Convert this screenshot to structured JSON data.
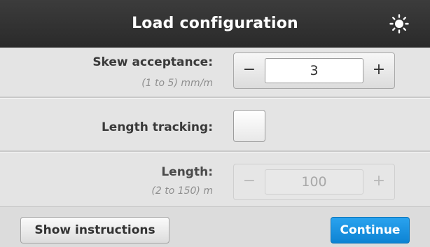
{
  "header": {
    "title": "Load configuration",
    "icon": "brightness-icon"
  },
  "skew": {
    "label": "Skew acceptance:",
    "range": "(1 to 5) mm/m",
    "value": "3",
    "decrement": "−",
    "increment": "+"
  },
  "length_tracking": {
    "label": "Length tracking:",
    "checked": false
  },
  "length": {
    "label": "Length:",
    "range": "(2 to 150) m",
    "value": "100",
    "decrement": "−",
    "increment": "+",
    "enabled": false
  },
  "footer": {
    "show_instructions": "Show instructions",
    "continue": "Continue"
  },
  "colors": {
    "header_bg": "#333333",
    "accent": "#1893e0"
  }
}
